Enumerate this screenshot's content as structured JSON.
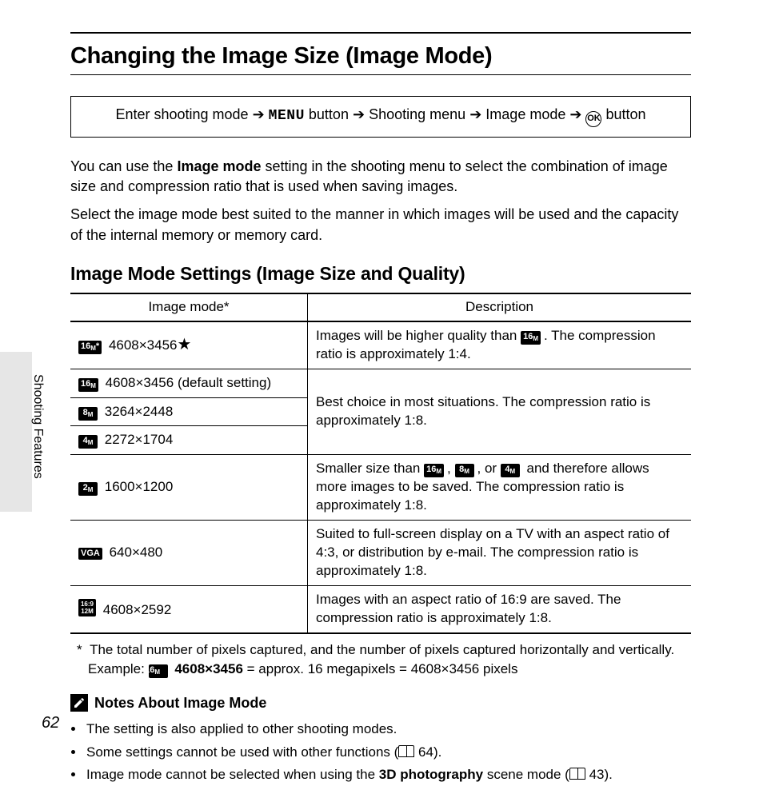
{
  "page_number": "62",
  "side_label": "Shooting Features",
  "title": "Changing the Image Size (Image Mode)",
  "nav": {
    "step1": "Enter shooting mode",
    "menu_label": "MENU",
    "step2_suffix": "button",
    "step3": "Shooting menu",
    "step4": "Image mode",
    "ok_label": "OK",
    "step5_suffix": "button"
  },
  "intro1_pre": "You can use the ",
  "intro1_bold": "Image mode",
  "intro1_post": " setting in the shooting menu to select the combination of image size and compression ratio that is used when saving images.",
  "intro2": "Select the image mode best suited to the manner in which images will be used and the capacity of the internal memory or memory card.",
  "subhead": "Image Mode Settings (Image Size and Quality)",
  "table": {
    "headers": {
      "col1": "Image mode*",
      "col2": "Description"
    },
    "rows": {
      "r1": {
        "icon": "16M*",
        "size": "4608×3456",
        "star": "★",
        "desc_pre": "Images will be higher quality than ",
        "desc_icon": "16M",
        "desc_post": ". The compression ratio is approximately 1:4."
      },
      "r2": {
        "icon": "16M",
        "size": "4608×3456 (default setting)"
      },
      "r3": {
        "icon": "8M",
        "size": "3264×2448"
      },
      "r4": {
        "icon": "4M",
        "size": "2272×1704"
      },
      "r_group_desc": "Best choice in most situations. The compression ratio is approximately 1:8.",
      "r5": {
        "icon": "2M",
        "size": "1600×1200",
        "desc_pre": "Smaller size than ",
        "icons": {
          "a": "16M",
          "b": "8M",
          "c": "4M"
        },
        "desc_mid_sep": ", ",
        "desc_last_sep": ", or ",
        "desc_post": " and therefore allows more images to be saved. The compression ratio is approximately 1:8."
      },
      "r6": {
        "icon": "VGA",
        "size": "640×480",
        "desc": "Suited to full-screen display on a TV with an aspect ratio of 4:3, or distribution by e-mail. The compression ratio is approximately 1:8."
      },
      "r7": {
        "icon": "16:9 12M",
        "size": "4608×2592",
        "desc": "Images with an aspect ratio of 16:9 are saved. The compression ratio is approximately 1:8."
      }
    }
  },
  "footnote": {
    "marker": "*",
    "text_line1": "The total number of pixels captured, and the number of pixels captured horizontally and vertically.",
    "example_pre": "Example: ",
    "example_icon": "16M",
    "example_bold": "4608×3456",
    "example_post": " = approx. 16 megapixels = 4608×3456 pixels"
  },
  "notes": {
    "heading": "Notes About Image Mode",
    "items": {
      "n1": "The setting is also applied to other shooting modes.",
      "n2_pre": "Some settings cannot be used with other functions (",
      "n2_ref": "64",
      "n2_post": ").",
      "n3_pre": "Image mode cannot be selected when using the ",
      "n3_bold": "3D photography",
      "n3_mid": " scene mode (",
      "n3_ref": "43",
      "n3_post": ")."
    }
  }
}
